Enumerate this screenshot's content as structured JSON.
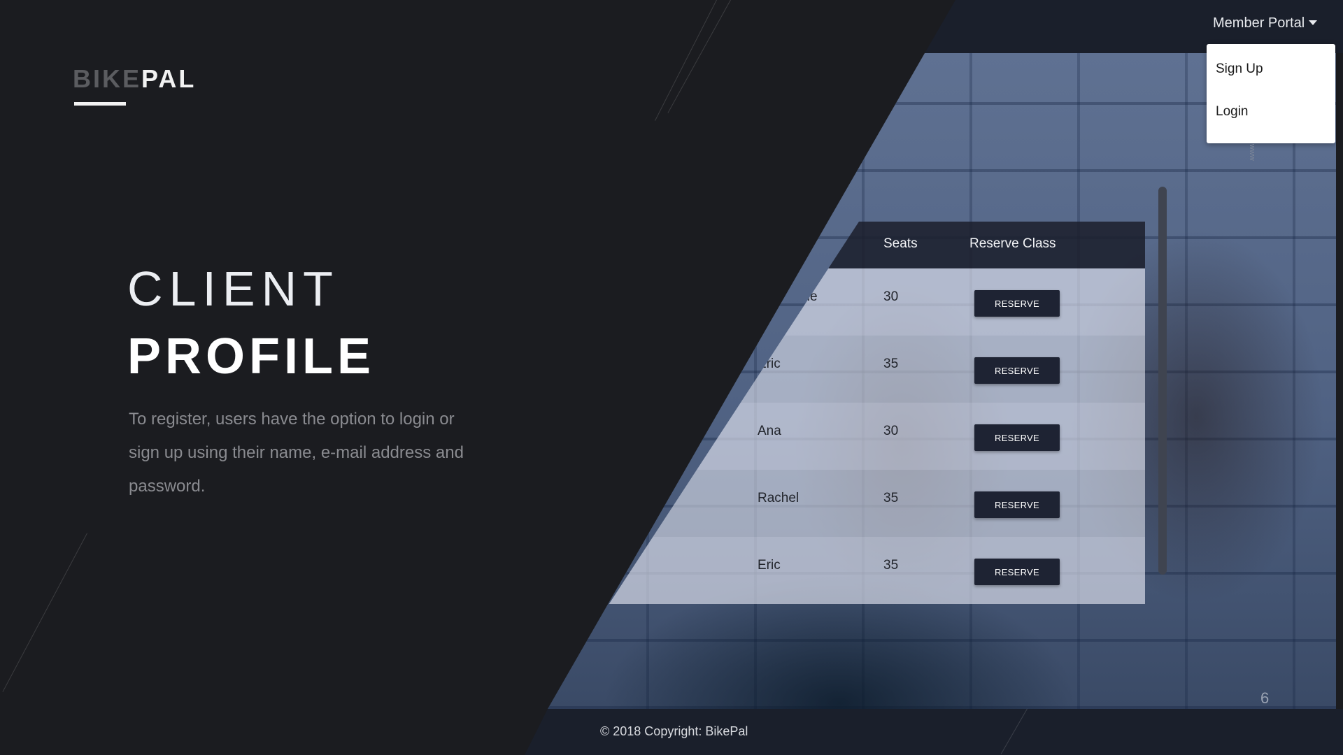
{
  "brand": {
    "part1": "BIKE",
    "part2": "PAL"
  },
  "hero": {
    "title_light": "CLIENT",
    "title_bold": "PROFILE",
    "description": "To register, users have the option to login or sign up using their name, e-mail address and password."
  },
  "nav": {
    "toggle_label": "Member Portal",
    "dropdown": [
      "Sign Up",
      "Login"
    ]
  },
  "table": {
    "headers": {
      "seats": "Seats",
      "reserve": "Reserve Class"
    },
    "rows": [
      {
        "name": "Stephanie",
        "seats": "30",
        "action": "RESERVE"
      },
      {
        "name": "Eric",
        "seats": "35",
        "action": "RESERVE"
      },
      {
        "name": "Ana",
        "seats": "30",
        "action": "RESERVE"
      },
      {
        "name": "Rachel",
        "seats": "35",
        "action": "RESERVE"
      },
      {
        "name": "Eric",
        "seats": "35",
        "action": "RESERVE"
      }
    ]
  },
  "footer": {
    "copyright": "© 2018 Copyright: BikePal"
  },
  "page_number": "6",
  "photo_text": "www",
  "colors": {
    "background": "#1b1c20",
    "band": "#1a1f2b",
    "button": "#1e2333",
    "accent_text": "#ffffff"
  }
}
